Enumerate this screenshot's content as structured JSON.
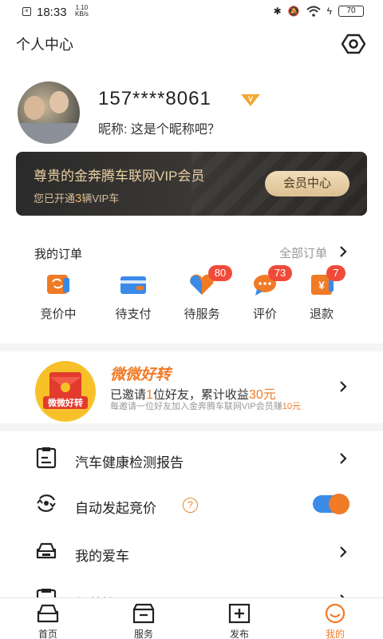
{
  "status_bar": {
    "time": "18:33",
    "net_speed_value": "1.10",
    "net_speed_unit": "KB/s",
    "battery": "70"
  },
  "header": {
    "title": "个人中心"
  },
  "profile": {
    "phone": "157****8061",
    "nickname": "昵称: 这是个昵称吧？"
  },
  "vip_card": {
    "title": "尊贵的金奔腾车联网VIP会员",
    "subtitle_prefix": "您已开通",
    "vip_count": "3",
    "subtitle_suffix": "辆VIP车",
    "button": "会员中心"
  },
  "orders": {
    "title": "我的订单",
    "all_label": "全部订单",
    "items": [
      {
        "label": "竞价中",
        "badge": ""
      },
      {
        "label": "待支付",
        "badge": ""
      },
      {
        "label": "待服务",
        "badge": "80"
      },
      {
        "label": "评价",
        "badge": "73"
      },
      {
        "label": "退款",
        "badge": "7"
      }
    ]
  },
  "invite": {
    "brand": "微微好转",
    "line1_prefix": "已邀请",
    "invited_count": "1",
    "line1_mid": "位好友，累计收益",
    "earnings": "30元",
    "line2_prefix": "每邀请一位好友加入金奔腾车联网VIP会员赚",
    "reward": "10元",
    "logo_text": "微微好转"
  },
  "menu": [
    {
      "label": "汽车健康检测报告"
    },
    {
      "label": "自动发起竞价",
      "help": "?",
      "toggle_on": true
    },
    {
      "label": "我的爱车"
    },
    {
      "label": "保养管理"
    }
  ],
  "tabbar": {
    "items": [
      {
        "label": "首页"
      },
      {
        "label": "服务"
      },
      {
        "label": "发布"
      },
      {
        "label": "我的"
      }
    ],
    "active": "我的"
  },
  "colors": {
    "accent": "#f07a25",
    "badge": "#f04b3a",
    "toggle_track": "#3a8ae8",
    "vip_gold": "#e8cfa0"
  }
}
